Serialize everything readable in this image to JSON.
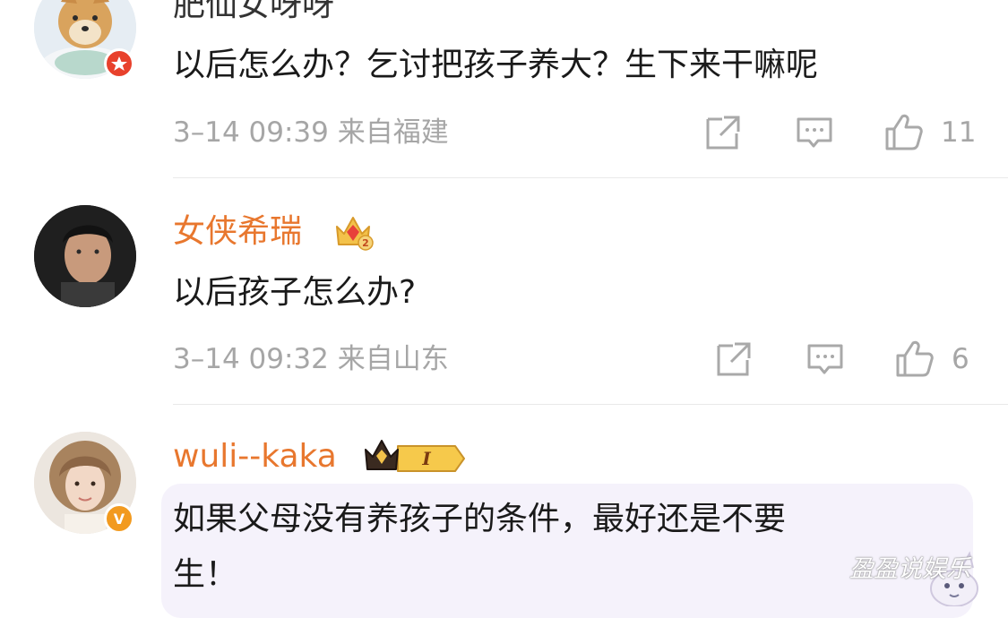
{
  "comments": [
    {
      "username": "肥仙女呀呀",
      "text": "以后怎么办？乞讨把孩子养大？生下来干嘛呢",
      "meta": "3–14 09:39 来自福建",
      "likes": "11",
      "avatar": "shiba-dog-avatar",
      "badge": "red-verified-badge",
      "username_color": "#333333"
    },
    {
      "username": "女侠希瑞",
      "text": "以后孩子怎么办?",
      "meta": "3–14 09:32 来自山东",
      "likes": "6",
      "avatar": "man-portrait-avatar",
      "badge": "vip-crown-badge",
      "crown_level": "2",
      "username_color": "#e8772e"
    },
    {
      "username": "wuli--kaka",
      "text_line1": "如果父母没有养孩子的条件，最好还是不要",
      "text_line2": "生！",
      "avatar": "woman-portrait-avatar",
      "badge": "orange-v-badge",
      "badge_letter": "V",
      "crown_level": "I",
      "username_color": "#e8772e"
    }
  ],
  "watermark": "盈盈说娱乐",
  "colors": {
    "accent_orange": "#e8772e",
    "meta_gray": "#a6a6a6",
    "divider": "#e9e9e9",
    "bubble": "#f5f2fb"
  }
}
